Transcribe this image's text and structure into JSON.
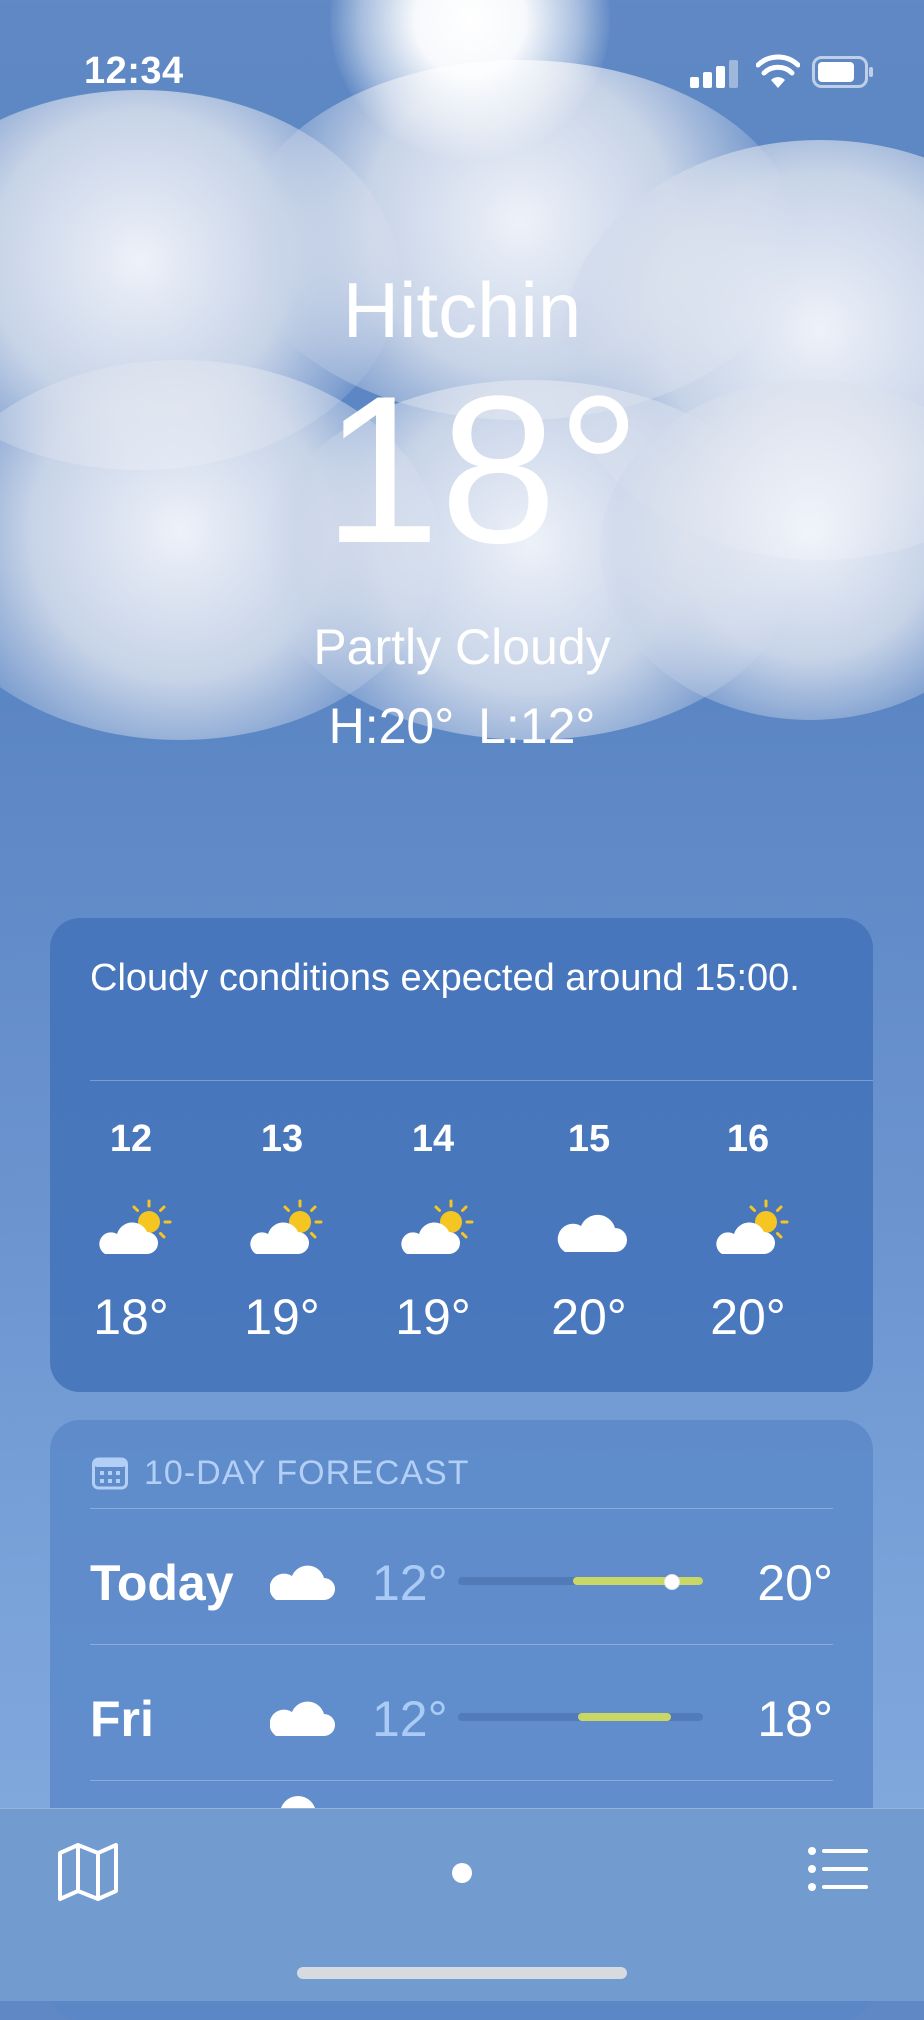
{
  "status_bar": {
    "time": "12:34"
  },
  "location": {
    "city": "Hitchin",
    "temperature": "18°",
    "condition": "Partly Cloudy",
    "high_low": "H:20°  L:12°"
  },
  "hourly": {
    "summary": "Cloudy conditions expected around 15:00.",
    "hours": [
      {
        "hour": "12",
        "icon": "partly-cloudy-icon",
        "temp": "18°"
      },
      {
        "hour": "13",
        "icon": "partly-cloudy-icon",
        "temp": "19°"
      },
      {
        "hour": "14",
        "icon": "partly-cloudy-icon",
        "temp": "19°"
      },
      {
        "hour": "15",
        "icon": "cloud-icon",
        "temp": "20°"
      },
      {
        "hour": "16",
        "icon": "partly-cloudy-icon",
        "temp": "20°"
      }
    ]
  },
  "ten_day": {
    "title": "10-DAY FORECAST",
    "days": [
      {
        "day": "Today",
        "icon": "cloud-icon",
        "low": "12°",
        "high": "20°",
        "range_start": 0.47,
        "range_end": 1.0,
        "current": 0.87
      },
      {
        "day": "Fri",
        "icon": "cloud-icon",
        "low": "12°",
        "high": "18°",
        "range_start": 0.49,
        "range_end": 0.87
      }
    ]
  },
  "colors": {
    "range_bar": "#c9d765",
    "low_temp": "#a9cbf6",
    "sun": "#f5c521"
  }
}
